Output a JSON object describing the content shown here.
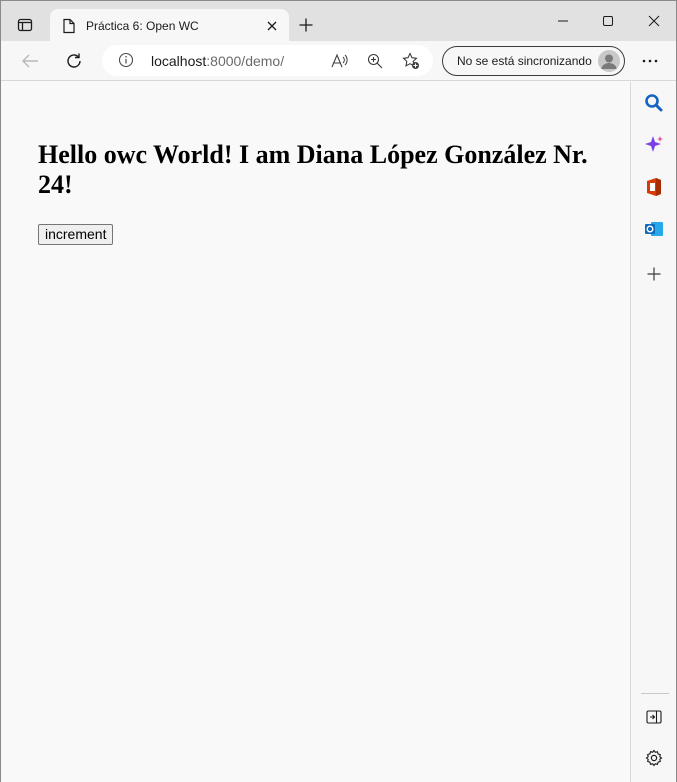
{
  "tab": {
    "title": "Práctica 6: Open WC"
  },
  "address": {
    "host": "localhost",
    "rest": ":8000/demo/"
  },
  "profile": {
    "sync_label": "No se está sincronizando"
  },
  "page": {
    "heading": "Hello owc World! I am Diana López González Nr. 24!",
    "increment_label": "increment"
  },
  "colors": {
    "accent": "#0f6cbd",
    "tab_bg": "#f7f7f7",
    "titlebar_bg": "#e1e1e1",
    "page_bg": "#f9f9f9"
  },
  "icons": {
    "tab_actions": "tab-actions-icon",
    "page": "page-icon",
    "close": "close-icon",
    "new_tab": "plus-icon",
    "minimize": "minimize-icon",
    "maximize": "maximize-icon",
    "window_close": "window-close-icon",
    "back": "back-arrow-icon",
    "refresh": "refresh-icon",
    "info": "info-icon",
    "read_aloud": "read-aloud-icon",
    "zoom": "zoom-in-icon",
    "favorites": "add-favorite-icon",
    "more": "more-icon",
    "sidebar": [
      "search-icon",
      "copilot-icon",
      "office-icon",
      "outlook-icon",
      "add-icon",
      "hide-sidebar-icon",
      "settings-icon"
    ]
  }
}
